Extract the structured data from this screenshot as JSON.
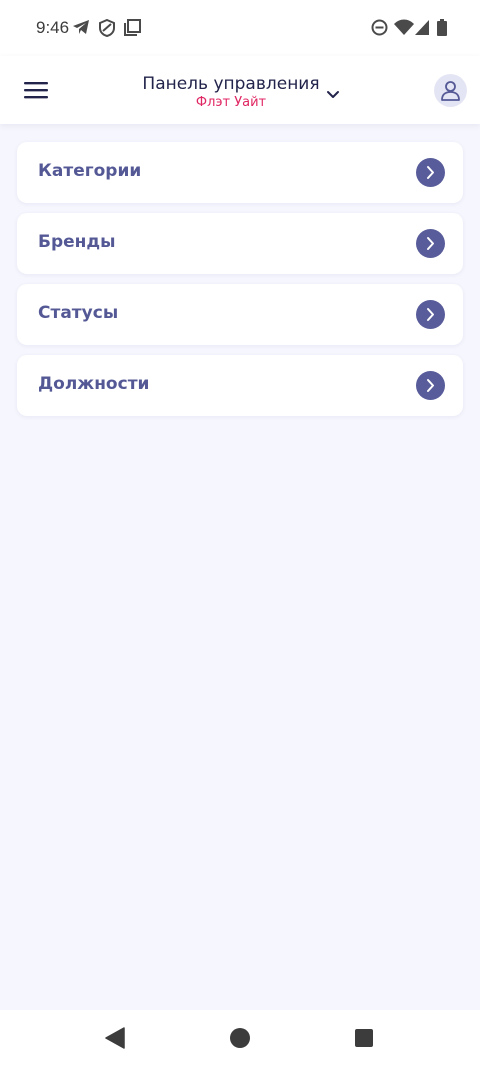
{
  "status_bar": {
    "time": "9:46",
    "icons": [
      "telegram-icon",
      "shield-icon",
      "copy-icon",
      "dnd-icon",
      "wifi-icon",
      "signal-icon",
      "battery-icon"
    ]
  },
  "app_bar": {
    "title": "Панель управления",
    "subtitle": "Флэт Уайт",
    "title_color": "#23244b",
    "subtitle_color": "#e02662"
  },
  "menu": {
    "items": [
      {
        "label": "Категории"
      },
      {
        "label": "Бренды"
      },
      {
        "label": "Статусы"
      },
      {
        "label": "Должности"
      }
    ],
    "accent": "#585c9a"
  },
  "nav_bar": {
    "icons": [
      "back-icon",
      "home-icon",
      "recents-icon"
    ]
  }
}
